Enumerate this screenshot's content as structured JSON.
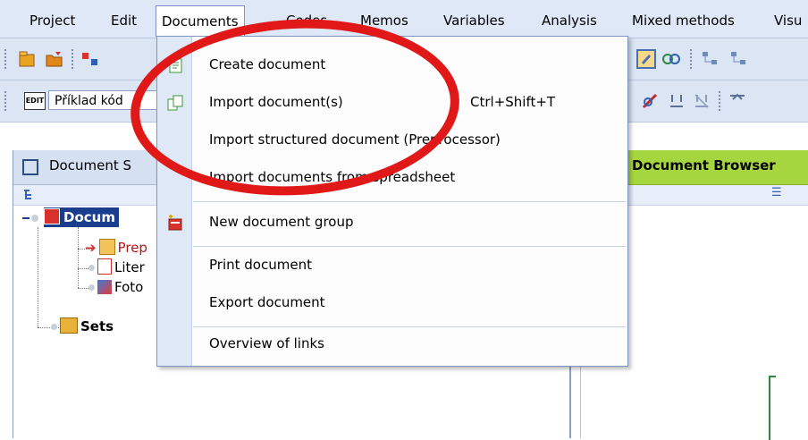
{
  "menubar": {
    "items": [
      {
        "label": "Project"
      },
      {
        "label": "Edit"
      },
      {
        "label": "Documents"
      },
      {
        "label": "Codes"
      },
      {
        "label": "Memos"
      },
      {
        "label": "Variables"
      },
      {
        "label": "Analysis"
      },
      {
        "label": "Mixed methods"
      },
      {
        "label": "Visu"
      }
    ]
  },
  "toolbar2": {
    "edit_badge": "EDIT",
    "document_combo": "Příklad kód"
  },
  "left_pane": {
    "title": "Document S",
    "tree": [
      {
        "label": "Docum"
      },
      {
        "label": "Prep"
      },
      {
        "label": "Liter"
      },
      {
        "label": "Foto"
      },
      {
        "label": "Sets"
      }
    ]
  },
  "right_pane": {
    "title": "Document Browser"
  },
  "dropdown": {
    "items": [
      {
        "label": "Create document",
        "shortcut": ""
      },
      {
        "label": "Import document(s)",
        "shortcut": "Ctrl+Shift+T"
      },
      {
        "label": "Import structured document (Preprocessor)",
        "shortcut": ""
      },
      {
        "label": "Import documents from spreadsheet",
        "shortcut": ""
      },
      {
        "label": "New document group",
        "shortcut": ""
      },
      {
        "label": "Print document",
        "shortcut": ""
      },
      {
        "label": "Export document",
        "shortcut": ""
      },
      {
        "label": "Overview of links",
        "shortcut": ""
      }
    ]
  },
  "colors": {
    "menubar_bg": "#dfe8f6",
    "browser_header": "#a6d63f",
    "annotation": "#e01818",
    "tree_selected": "#1a3d8f"
  }
}
